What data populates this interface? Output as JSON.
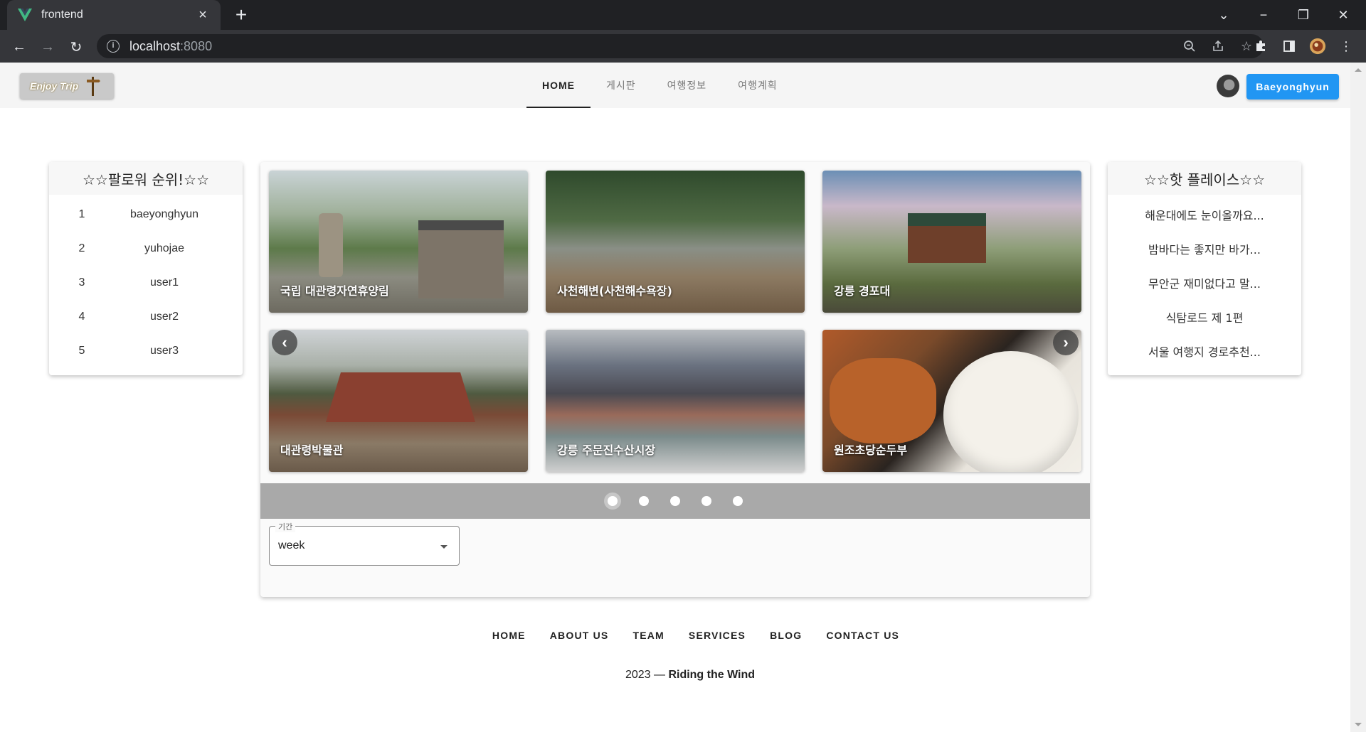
{
  "browser": {
    "tab_title": "frontend",
    "url_host": "localhost",
    "url_port": ":8080"
  },
  "header": {
    "logo_text": "Enjoy Trip",
    "nav": [
      "HOME",
      "게시판",
      "여행정보",
      "여행계획"
    ],
    "active_nav": "HOME",
    "user_button": "Baeyonghyun"
  },
  "ranking": {
    "title": "☆☆팔로워 순위!☆☆",
    "rows": [
      {
        "rank": "1",
        "name": "baeyonghyun"
      },
      {
        "rank": "2",
        "name": "yuhojae"
      },
      {
        "rank": "3",
        "name": "user1"
      },
      {
        "rank": "4",
        "name": "user2"
      },
      {
        "rank": "5",
        "name": "user3"
      }
    ]
  },
  "hot_places": {
    "title": "☆☆핫 플레이스☆☆",
    "items": [
      "해운대에도 눈이올까요...",
      "밤바다는 좋지만 바가...",
      "무안군 재미없다고 말...",
      "식탐로드 제 1편",
      "서울 여행지 경로추천..."
    ]
  },
  "carousel": {
    "slides": [
      {
        "label": "국립 대관령자연휴양림"
      },
      {
        "label": "사천해변(사천해수욕장)"
      },
      {
        "label": "강릉 경포대"
      },
      {
        "label": "대관령박물관"
      },
      {
        "label": "강릉 주문진수산시장"
      },
      {
        "label": "원조초당순두부"
      }
    ],
    "pages": 5,
    "active_page": 1
  },
  "period_select": {
    "legend": "기간",
    "value": "week"
  },
  "footer": {
    "links": [
      "HOME",
      "ABOUT US",
      "TEAM",
      "SERVICES",
      "BLOG",
      "CONTACT US"
    ],
    "year_text": "2023 — ",
    "brand": "Riding the Wind"
  }
}
